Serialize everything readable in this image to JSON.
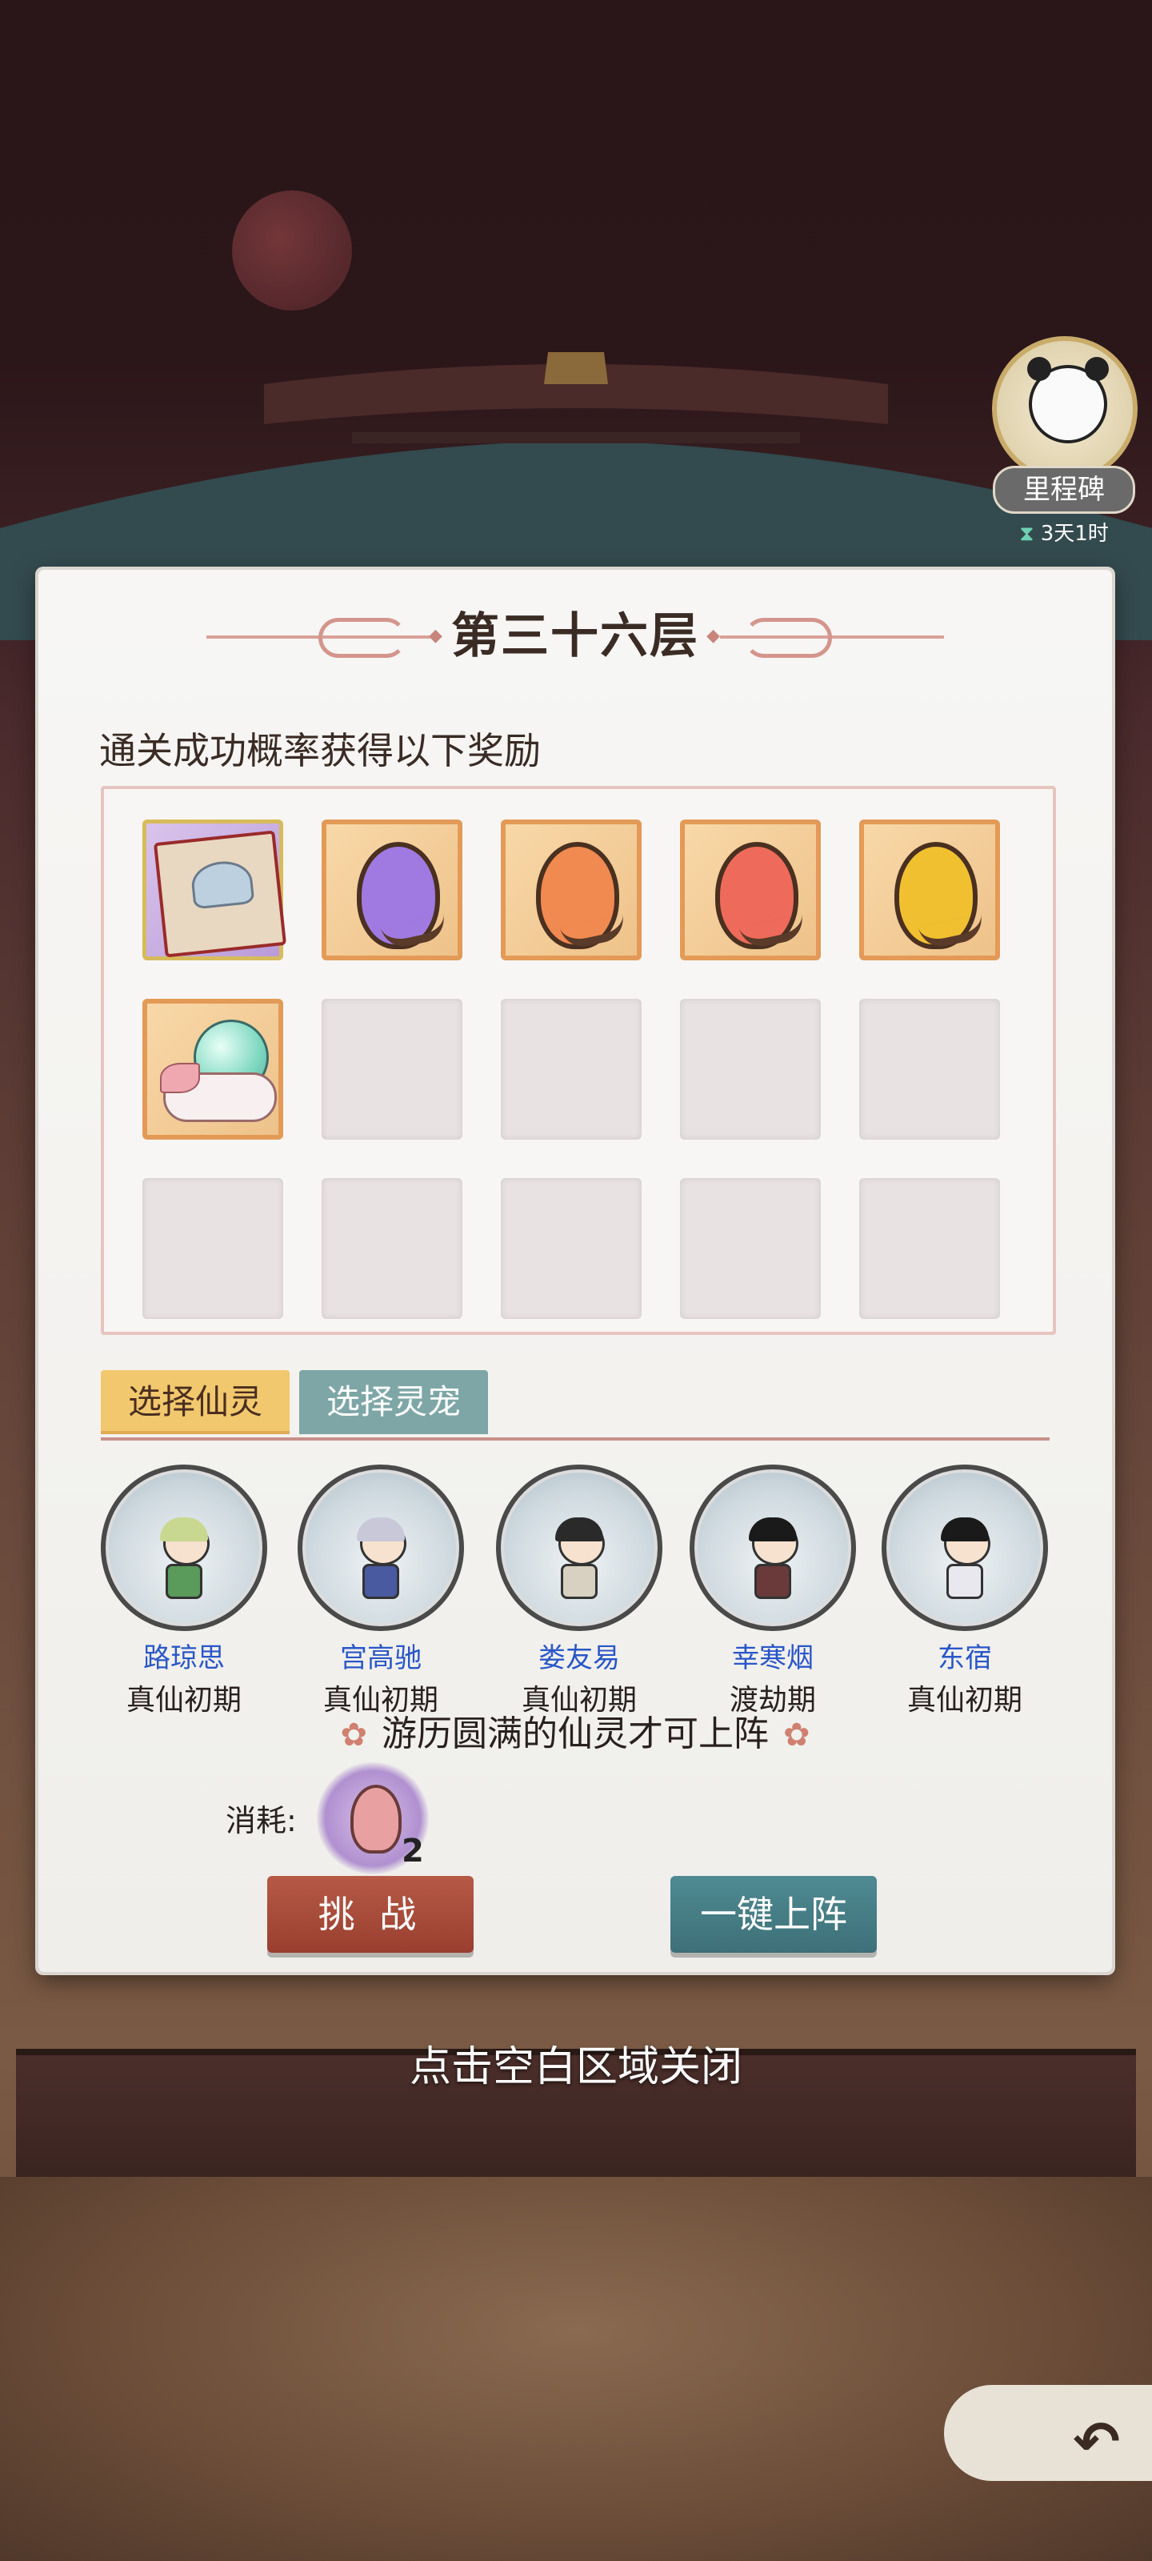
{
  "milestone": {
    "label": "里程碑",
    "timer": "3天1时"
  },
  "panel": {
    "title": "第三十六层",
    "subtitle": "通关成功概率获得以下奖励"
  },
  "rewards": {
    "slots": [
      {
        "icon": "book-item-icon",
        "style": "purple"
      },
      {
        "icon": "purple-egg-icon",
        "style": "orange",
        "color": "#a07ae0"
      },
      {
        "icon": "orange-egg-icon",
        "style": "orange",
        "color": "#f08a50"
      },
      {
        "icon": "red-egg-icon",
        "style": "orange",
        "color": "#ee6a5a"
      },
      {
        "icon": "gold-egg-icon",
        "style": "orange",
        "color": "#f0c030"
      },
      {
        "icon": "cloud-orb-icon",
        "style": "orange"
      }
    ],
    "total_slots": 15
  },
  "tabs": {
    "active": "选择仙灵",
    "inactive": "选择灵宠"
  },
  "spirits": [
    {
      "name": "路琼思",
      "rank": "真仙初期",
      "hair": "#c8d890",
      "body": "#5a9a5a"
    },
    {
      "name": "宫高驰",
      "rank": "真仙初期",
      "hair": "#c8c8d8",
      "body": "#4a5aa0"
    },
    {
      "name": "娄友易",
      "rank": "真仙初期",
      "hair": "#2a2a2a",
      "body": "#d8d0c0"
    },
    {
      "name": "幸寒烟",
      "rank": "渡劫期",
      "hair": "#1a1a1a",
      "body": "#6a3a3a"
    },
    {
      "name": "东宿",
      "rank": "真仙初期",
      "hair": "#1a1a1a",
      "body": "#e8e8ee"
    }
  ],
  "notice": "游历圆满的仙灵才可上阵",
  "cost": {
    "label": "消耗:",
    "count": "2"
  },
  "buttons": {
    "challenge": "挑 战",
    "deploy": "一键上阵"
  },
  "close_hint": "点击空白区域关闭",
  "colors": {
    "spirit_name": "#2a56c8",
    "challenge_btn": "#a44a3a",
    "deploy_btn": "#47808a",
    "tab_active": "#f2c86e",
    "tab_inactive": "#7ea6a6"
  }
}
